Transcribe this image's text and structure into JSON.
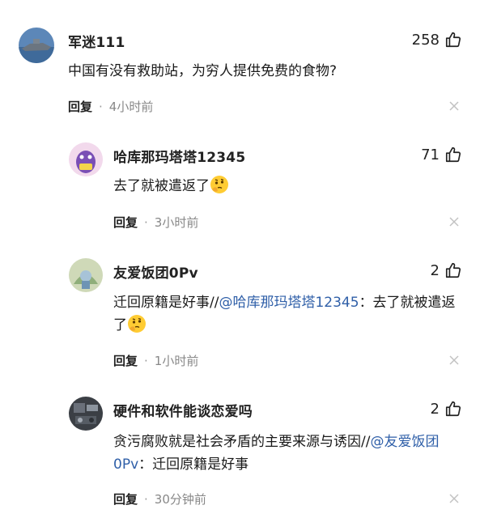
{
  "comments": [
    {
      "username": "军迷111",
      "likes": "258",
      "text": "中国有没有救助站，为穷人提供免费的食物?",
      "reply_label": "回复",
      "time": "4小时前"
    },
    {
      "username": "哈库那玛塔塔12345",
      "likes": "71",
      "text": "去了就被遣返了",
      "reply_label": "回复",
      "time": "3小时前"
    },
    {
      "username": "友爱饭团0Pv",
      "likes": "2",
      "text_prefix": "迁回原籍是好事//",
      "mention": "@哈库那玛塔塔12345",
      "text_suffix": "：去了就被遣返了",
      "reply_label": "回复",
      "time": "1小时前"
    },
    {
      "username": "硬件和软件能谈恋爱吗",
      "likes": "2",
      "text_prefix": "贪污腐败就是社会矛盾的主要来源与诱因//",
      "mention": "@友爱饭团0Pv",
      "text_suffix": "：迁回原籍是好事",
      "reply_label": "回复",
      "time": "30分钟前"
    }
  ],
  "separator": "·",
  "icons": {
    "like": "thumbs-up-icon",
    "close": "close-icon",
    "emoji": "thinking-face-emoji"
  }
}
